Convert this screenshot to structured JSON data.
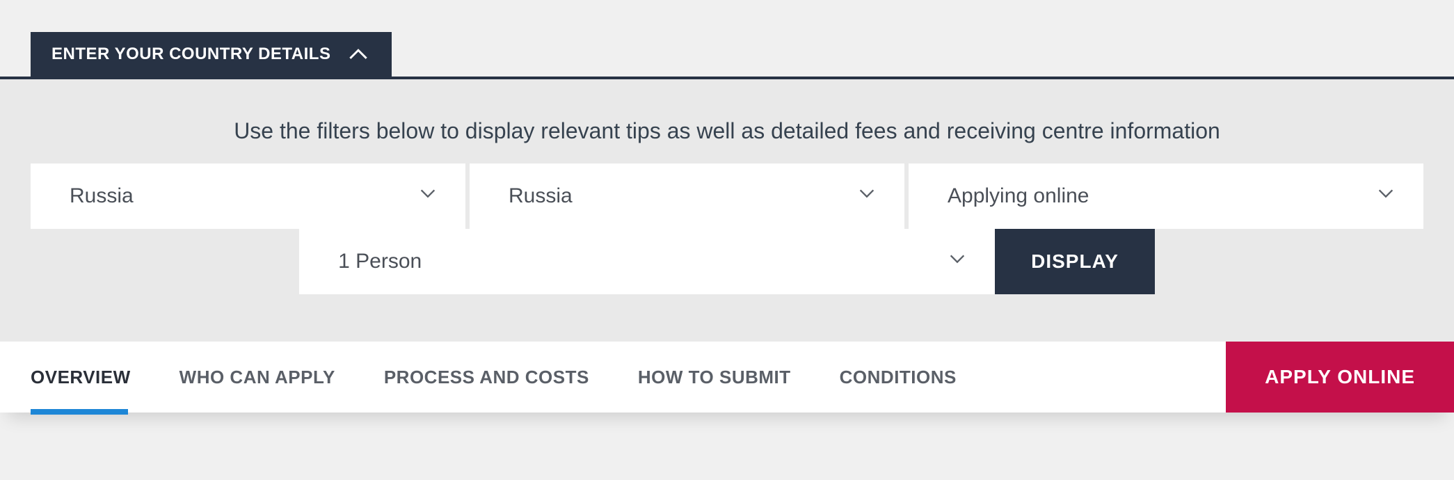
{
  "accordion": {
    "title": "ENTER YOUR COUNTRY DETAILS"
  },
  "filters": {
    "instructions": "Use the filters below to display relevant tips as well as detailed fees and receiving centre information",
    "country1": "Russia",
    "country2": "Russia",
    "method": "Applying online",
    "persons": "1 Person",
    "display_button": "DISPLAY"
  },
  "tabs": {
    "items": [
      {
        "label": "OVERVIEW",
        "active": true
      },
      {
        "label": "WHO CAN APPLY",
        "active": false
      },
      {
        "label": "PROCESS AND COSTS",
        "active": false
      },
      {
        "label": "HOW TO SUBMIT",
        "active": false
      },
      {
        "label": "CONDITIONS",
        "active": false
      }
    ],
    "apply_button": "APPLY ONLINE"
  }
}
